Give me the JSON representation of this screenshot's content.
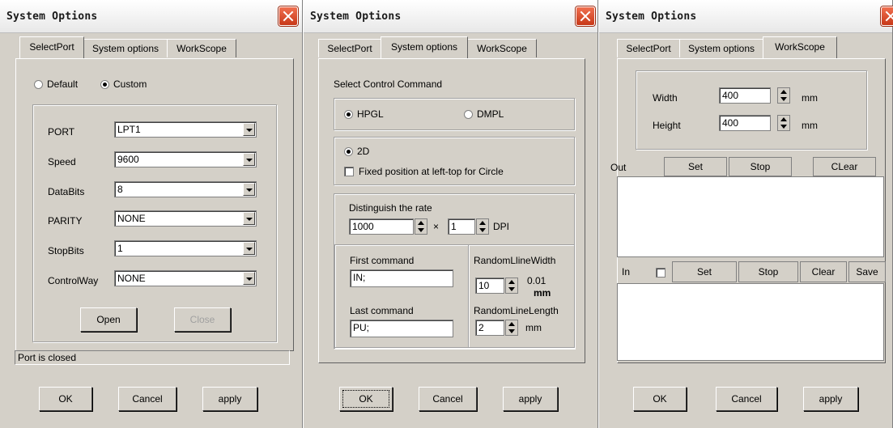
{
  "windows": [
    {
      "title": "System Options",
      "tabs": [
        "SelectPort",
        "System options",
        "WorkScope"
      ],
      "radio": {
        "default_label": "Default",
        "custom_label": "Custom"
      },
      "rows": [
        {
          "label": "PORT",
          "value": "LPT1"
        },
        {
          "label": "Speed",
          "value": "9600"
        },
        {
          "label": "DataBits",
          "value": "8"
        },
        {
          "label": "PARITY",
          "value": "NONE"
        },
        {
          "label": "StopBits",
          "value": "1"
        },
        {
          "label": "ControlWay",
          "value": "NONE"
        }
      ],
      "open_label": "Open",
      "close_label": "Close",
      "status": "Port is closed",
      "footer": {
        "ok": "OK",
        "cancel": "Cancel",
        "apply": "apply"
      }
    },
    {
      "title": "System Options",
      "tabs": [
        "SelectPort",
        "System options",
        "WorkScope"
      ],
      "select_control_label": "Select Control Command",
      "hpgl_label": "HPGL",
      "dmpl_label": "DMPL",
      "twod_label": "2D",
      "fixed_label": "Fixed position at left-top for Circle",
      "rate_label": "Distinguish the rate",
      "rate_value": "1000",
      "times_label": "×",
      "rate_mult": "1",
      "dpi_label": "DPI",
      "first_command_label": "First command",
      "first_command_value": "IN;",
      "last_command_label": "Last command",
      "last_command_value": "PU;",
      "random_width_label": "RandomLlineWidth",
      "random_width_value": "10",
      "width_unit_value": "0.01",
      "width_unit_mm": "mm",
      "random_length_label": "RandomLineLength",
      "random_length_value": "2",
      "length_unit": "mm",
      "footer": {
        "ok": "OK",
        "cancel": "Cancel",
        "apply": "apply"
      }
    },
    {
      "title": "System Options",
      "tabs": [
        "SelectPort",
        "System options",
        "WorkScope"
      ],
      "width_label": "Width",
      "width_value": "400",
      "width_unit": "mm",
      "height_label": "Height",
      "height_value": "400",
      "height_unit": "mm",
      "out": {
        "label": "Out",
        "set": "Set",
        "stop": "Stop",
        "clear": "CLear"
      },
      "in": {
        "label": "In",
        "set": "Set",
        "stop": "Stop",
        "clear": "Clear",
        "save": "Save"
      },
      "footer": {
        "ok": "OK",
        "cancel": "Cancel",
        "apply": "apply"
      }
    }
  ]
}
